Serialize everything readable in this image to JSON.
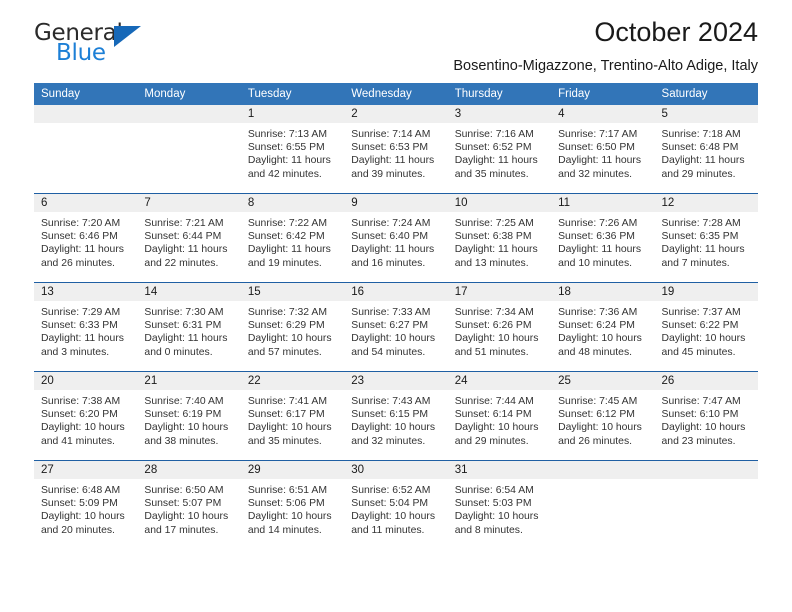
{
  "brand": {
    "name_part1": "General",
    "name_part2": "Blue"
  },
  "header": {
    "title": "October 2024",
    "subtitle": "Bosentino-Migazzone, Trentino-Alto Adige, Italy"
  },
  "colors": {
    "header_blue": "#3275b8",
    "row_separator_blue": "#1f5fa3",
    "daynum_band": "#efefef",
    "logo_blue": "#1668b8"
  },
  "weekday_headers": [
    "Sunday",
    "Monday",
    "Tuesday",
    "Wednesday",
    "Thursday",
    "Friday",
    "Saturday"
  ],
  "weeks": [
    [
      {
        "day": "",
        "lines": []
      },
      {
        "day": "",
        "lines": []
      },
      {
        "day": "1",
        "lines": [
          "Sunrise: 7:13 AM",
          "Sunset: 6:55 PM",
          "Daylight: 11 hours",
          "and 42 minutes."
        ]
      },
      {
        "day": "2",
        "lines": [
          "Sunrise: 7:14 AM",
          "Sunset: 6:53 PM",
          "Daylight: 11 hours",
          "and 39 minutes."
        ]
      },
      {
        "day": "3",
        "lines": [
          "Sunrise: 7:16 AM",
          "Sunset: 6:52 PM",
          "Daylight: 11 hours",
          "and 35 minutes."
        ]
      },
      {
        "day": "4",
        "lines": [
          "Sunrise: 7:17 AM",
          "Sunset: 6:50 PM",
          "Daylight: 11 hours",
          "and 32 minutes."
        ]
      },
      {
        "day": "5",
        "lines": [
          "Sunrise: 7:18 AM",
          "Sunset: 6:48 PM",
          "Daylight: 11 hours",
          "and 29 minutes."
        ]
      }
    ],
    [
      {
        "day": "6",
        "lines": [
          "Sunrise: 7:20 AM",
          "Sunset: 6:46 PM",
          "Daylight: 11 hours",
          "and 26 minutes."
        ]
      },
      {
        "day": "7",
        "lines": [
          "Sunrise: 7:21 AM",
          "Sunset: 6:44 PM",
          "Daylight: 11 hours",
          "and 22 minutes."
        ]
      },
      {
        "day": "8",
        "lines": [
          "Sunrise: 7:22 AM",
          "Sunset: 6:42 PM",
          "Daylight: 11 hours",
          "and 19 minutes."
        ]
      },
      {
        "day": "9",
        "lines": [
          "Sunrise: 7:24 AM",
          "Sunset: 6:40 PM",
          "Daylight: 11 hours",
          "and 16 minutes."
        ]
      },
      {
        "day": "10",
        "lines": [
          "Sunrise: 7:25 AM",
          "Sunset: 6:38 PM",
          "Daylight: 11 hours",
          "and 13 minutes."
        ]
      },
      {
        "day": "11",
        "lines": [
          "Sunrise: 7:26 AM",
          "Sunset: 6:36 PM",
          "Daylight: 11 hours",
          "and 10 minutes."
        ]
      },
      {
        "day": "12",
        "lines": [
          "Sunrise: 7:28 AM",
          "Sunset: 6:35 PM",
          "Daylight: 11 hours",
          "and 7 minutes."
        ]
      }
    ],
    [
      {
        "day": "13",
        "lines": [
          "Sunrise: 7:29 AM",
          "Sunset: 6:33 PM",
          "Daylight: 11 hours",
          "and 3 minutes."
        ]
      },
      {
        "day": "14",
        "lines": [
          "Sunrise: 7:30 AM",
          "Sunset: 6:31 PM",
          "Daylight: 11 hours",
          "and 0 minutes."
        ]
      },
      {
        "day": "15",
        "lines": [
          "Sunrise: 7:32 AM",
          "Sunset: 6:29 PM",
          "Daylight: 10 hours",
          "and 57 minutes."
        ]
      },
      {
        "day": "16",
        "lines": [
          "Sunrise: 7:33 AM",
          "Sunset: 6:27 PM",
          "Daylight: 10 hours",
          "and 54 minutes."
        ]
      },
      {
        "day": "17",
        "lines": [
          "Sunrise: 7:34 AM",
          "Sunset: 6:26 PM",
          "Daylight: 10 hours",
          "and 51 minutes."
        ]
      },
      {
        "day": "18",
        "lines": [
          "Sunrise: 7:36 AM",
          "Sunset: 6:24 PM",
          "Daylight: 10 hours",
          "and 48 minutes."
        ]
      },
      {
        "day": "19",
        "lines": [
          "Sunrise: 7:37 AM",
          "Sunset: 6:22 PM",
          "Daylight: 10 hours",
          "and 45 minutes."
        ]
      }
    ],
    [
      {
        "day": "20",
        "lines": [
          "Sunrise: 7:38 AM",
          "Sunset: 6:20 PM",
          "Daylight: 10 hours",
          "and 41 minutes."
        ]
      },
      {
        "day": "21",
        "lines": [
          "Sunrise: 7:40 AM",
          "Sunset: 6:19 PM",
          "Daylight: 10 hours",
          "and 38 minutes."
        ]
      },
      {
        "day": "22",
        "lines": [
          "Sunrise: 7:41 AM",
          "Sunset: 6:17 PM",
          "Daylight: 10 hours",
          "and 35 minutes."
        ]
      },
      {
        "day": "23",
        "lines": [
          "Sunrise: 7:43 AM",
          "Sunset: 6:15 PM",
          "Daylight: 10 hours",
          "and 32 minutes."
        ]
      },
      {
        "day": "24",
        "lines": [
          "Sunrise: 7:44 AM",
          "Sunset: 6:14 PM",
          "Daylight: 10 hours",
          "and 29 minutes."
        ]
      },
      {
        "day": "25",
        "lines": [
          "Sunrise: 7:45 AM",
          "Sunset: 6:12 PM",
          "Daylight: 10 hours",
          "and 26 minutes."
        ]
      },
      {
        "day": "26",
        "lines": [
          "Sunrise: 7:47 AM",
          "Sunset: 6:10 PM",
          "Daylight: 10 hours",
          "and 23 minutes."
        ]
      }
    ],
    [
      {
        "day": "27",
        "lines": [
          "Sunrise: 6:48 AM",
          "Sunset: 5:09 PM",
          "Daylight: 10 hours",
          "and 20 minutes."
        ]
      },
      {
        "day": "28",
        "lines": [
          "Sunrise: 6:50 AM",
          "Sunset: 5:07 PM",
          "Daylight: 10 hours",
          "and 17 minutes."
        ]
      },
      {
        "day": "29",
        "lines": [
          "Sunrise: 6:51 AM",
          "Sunset: 5:06 PM",
          "Daylight: 10 hours",
          "and 14 minutes."
        ]
      },
      {
        "day": "30",
        "lines": [
          "Sunrise: 6:52 AM",
          "Sunset: 5:04 PM",
          "Daylight: 10 hours",
          "and 11 minutes."
        ]
      },
      {
        "day": "31",
        "lines": [
          "Sunrise: 6:54 AM",
          "Sunset: 5:03 PM",
          "Daylight: 10 hours",
          "and 8 minutes."
        ]
      },
      {
        "day": "",
        "lines": []
      },
      {
        "day": "",
        "lines": []
      }
    ]
  ]
}
